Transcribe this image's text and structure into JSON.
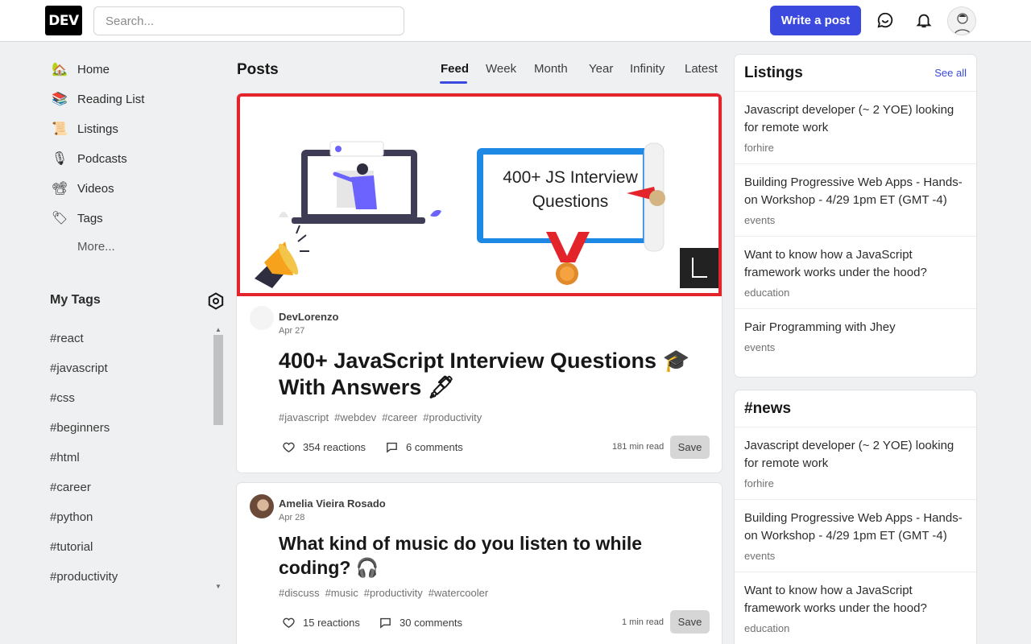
{
  "header": {
    "logo": "DEV",
    "search_placeholder": "Search...",
    "write_post": "Write a post"
  },
  "sidebar": {
    "nav": [
      {
        "label": "Home",
        "icon": "house-icon"
      },
      {
        "label": "Reading List",
        "icon": "bookmark-box-icon"
      },
      {
        "label": "Listings",
        "icon": "scroll-icon"
      },
      {
        "label": "Podcasts",
        "icon": "microphone-icon"
      },
      {
        "label": "Videos",
        "icon": "camera-icon"
      },
      {
        "label": "Tags",
        "icon": "tag-icon"
      }
    ],
    "more": "More...",
    "my_tags_title": "My Tags",
    "tags": [
      "#react",
      "#javascript",
      "#css",
      "#beginners",
      "#html",
      "#career",
      "#python",
      "#tutorial",
      "#productivity"
    ]
  },
  "feed": {
    "title": "Posts",
    "tabs": [
      "Feed",
      "Week",
      "Month",
      "Year",
      "Infinity",
      "Latest"
    ],
    "active_tab": "Feed"
  },
  "posts": [
    {
      "cover_text": "400+ JS Interview Questions",
      "cover_badge": "L",
      "author": "DevLorenzo",
      "date": "Apr 27",
      "title": "400+ JavaScript Interview Questions 🎓 With Answers 🖋",
      "tags": [
        "#javascript",
        "#webdev",
        "#career",
        "#productivity"
      ],
      "reactions": "354 reactions",
      "comments": "6 comments",
      "read_time": "181 min read",
      "save": "Save"
    },
    {
      "author": "Amelia Vieira Rosado",
      "date": "Apr 28",
      "title": "What kind of music do you listen to while coding? 🎧",
      "tags": [
        "#discuss",
        "#music",
        "#productivity",
        "#watercooler"
      ],
      "reactions": "15 reactions",
      "comments": "30 comments",
      "read_time": "1 min read",
      "save": "Save"
    }
  ],
  "listings": {
    "title": "Listings",
    "see_all": "See all",
    "items": [
      {
        "title": "Javascript developer (~ 2 YOE) looking for remote work",
        "category": "forhire"
      },
      {
        "title": "Building Progressive Web Apps - Hands-on Workshop - 4/29 1pm ET (GMT -4)",
        "category": "events"
      },
      {
        "title": "Want to know how a JavaScript framework works under the hood?",
        "category": "education"
      },
      {
        "title": "Pair Programming with Jhey",
        "category": "events"
      }
    ]
  },
  "news": {
    "title": "#news",
    "items": [
      {
        "title": "Javascript developer (~ 2 YOE) looking for remote work",
        "category": "forhire"
      },
      {
        "title": "Building Progressive Web Apps - Hands-on Workshop - 4/29 1pm ET (GMT -4)",
        "category": "events"
      },
      {
        "title": "Want to know how a JavaScript framework works under the hood?",
        "category": "education"
      }
    ]
  },
  "colors": {
    "accent": "#3b49df",
    "cover_border": "#e3242b",
    "background": "#eef0f1"
  }
}
